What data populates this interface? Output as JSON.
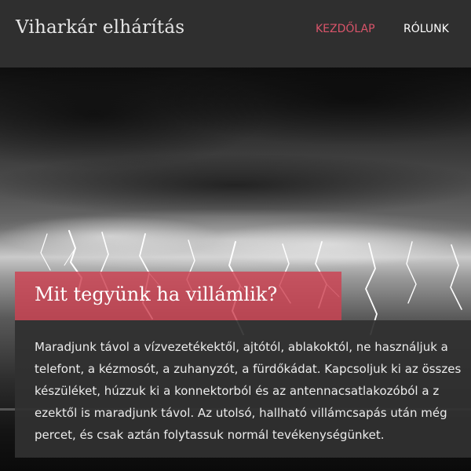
{
  "header": {
    "site_title": "Viharkár elhárítás",
    "nav": [
      {
        "label": "KEZDŐLAP",
        "active": true
      },
      {
        "label": "RÓLUNK",
        "active": false
      }
    ]
  },
  "article": {
    "title": "Mit tegyünk ha villámlik?",
    "body_lines": [
      "Maradjunk távol a vízvezetékektől, ajtótól, ablakoktól, ne használjuk a",
      "telefont, a kézmosót, a zuhanyzót, a fürdőkádat. Kapcsoljuk ki az összes",
      "készüléket, húzzuk ki a konnektorból és az antennacsatlakozóból a z",
      "ezektől is maradjunk távol. Az utolsó, hallható villámcsapás után még",
      "percet, és csak aztán folytassuk normál tevékenységünket."
    ]
  },
  "colors": {
    "header_bg": "#2f2f2f",
    "nav_active": "#d9546a",
    "nav_inactive": "#ffffff",
    "accent_red": "#cd4252",
    "card_bg": "#303030"
  }
}
